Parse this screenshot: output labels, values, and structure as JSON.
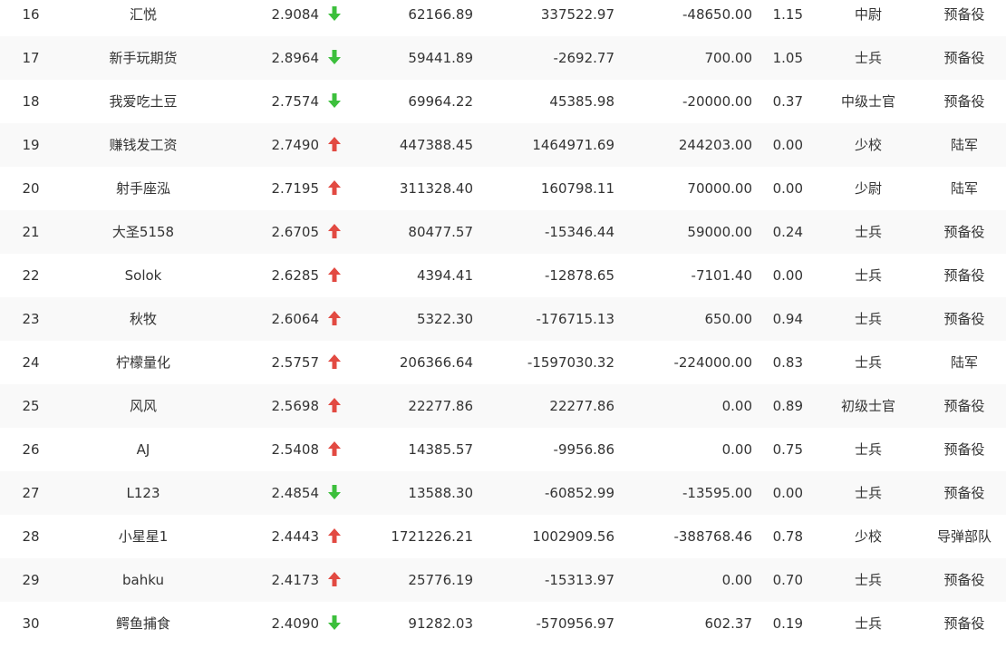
{
  "colors": {
    "up_arrow": "#e24a42",
    "down_arrow": "#3cbf3c",
    "text": "#333333"
  },
  "rows": [
    {
      "rank": "16",
      "name": "汇悦",
      "score": "2.9084",
      "trend": "down",
      "v1": "62166.89",
      "v2": "337522.97",
      "v3": "-48650.00",
      "ratio": "1.15",
      "title": "中尉",
      "unit": "预备役"
    },
    {
      "rank": "17",
      "name": "新手玩期货",
      "score": "2.8964",
      "trend": "down",
      "v1": "59441.89",
      "v2": "-2692.77",
      "v3": "700.00",
      "ratio": "1.05",
      "title": "士兵",
      "unit": "预备役"
    },
    {
      "rank": "18",
      "name": "我爱吃土豆",
      "score": "2.7574",
      "trend": "down",
      "v1": "69964.22",
      "v2": "45385.98",
      "v3": "-20000.00",
      "ratio": "0.37",
      "title": "中级士官",
      "unit": "预备役"
    },
    {
      "rank": "19",
      "name": "赚钱发工资",
      "score": "2.7490",
      "trend": "up",
      "v1": "447388.45",
      "v2": "1464971.69",
      "v3": "244203.00",
      "ratio": "0.00",
      "title": "少校",
      "unit": "陆军"
    },
    {
      "rank": "20",
      "name": "射手座泓",
      "score": "2.7195",
      "trend": "up",
      "v1": "311328.40",
      "v2": "160798.11",
      "v3": "70000.00",
      "ratio": "0.00",
      "title": "少尉",
      "unit": "陆军"
    },
    {
      "rank": "21",
      "name": "大圣5158",
      "score": "2.6705",
      "trend": "up",
      "v1": "80477.57",
      "v2": "-15346.44",
      "v3": "59000.00",
      "ratio": "0.24",
      "title": "士兵",
      "unit": "预备役"
    },
    {
      "rank": "22",
      "name": "Solok",
      "score": "2.6285",
      "trend": "up",
      "v1": "4394.41",
      "v2": "-12878.65",
      "v3": "-7101.40",
      "ratio": "0.00",
      "title": "士兵",
      "unit": "预备役"
    },
    {
      "rank": "23",
      "name": "秋牧",
      "score": "2.6064",
      "trend": "up",
      "v1": "5322.30",
      "v2": "-176715.13",
      "v3": "650.00",
      "ratio": "0.94",
      "title": "士兵",
      "unit": "预备役"
    },
    {
      "rank": "24",
      "name": "柠檬量化",
      "score": "2.5757",
      "trend": "up",
      "v1": "206366.64",
      "v2": "-1597030.32",
      "v3": "-224000.00",
      "ratio": "0.83",
      "title": "士兵",
      "unit": "陆军"
    },
    {
      "rank": "25",
      "name": "风风",
      "score": "2.5698",
      "trend": "up",
      "v1": "22277.86",
      "v2": "22277.86",
      "v3": "0.00",
      "ratio": "0.89",
      "title": "初级士官",
      "unit": "预备役"
    },
    {
      "rank": "26",
      "name": "AJ",
      "score": "2.5408",
      "trend": "up",
      "v1": "14385.57",
      "v2": "-9956.86",
      "v3": "0.00",
      "ratio": "0.75",
      "title": "士兵",
      "unit": "预备役"
    },
    {
      "rank": "27",
      "name": "L123",
      "score": "2.4854",
      "trend": "down",
      "v1": "13588.30",
      "v2": "-60852.99",
      "v3": "-13595.00",
      "ratio": "0.00",
      "title": "士兵",
      "unit": "预备役"
    },
    {
      "rank": "28",
      "name": "小星星1",
      "score": "2.4443",
      "trend": "up",
      "v1": "1721226.21",
      "v2": "1002909.56",
      "v3": "-388768.46",
      "ratio": "0.78",
      "title": "少校",
      "unit": "导弹部队"
    },
    {
      "rank": "29",
      "name": "bahku",
      "score": "2.4173",
      "trend": "up",
      "v1": "25776.19",
      "v2": "-15313.97",
      "v3": "0.00",
      "ratio": "0.70",
      "title": "士兵",
      "unit": "预备役"
    },
    {
      "rank": "30",
      "name": "鳄鱼捕食",
      "score": "2.4090",
      "trend": "down",
      "v1": "91282.03",
      "v2": "-570956.97",
      "v3": "602.37",
      "ratio": "0.19",
      "title": "士兵",
      "unit": "预备役"
    }
  ]
}
